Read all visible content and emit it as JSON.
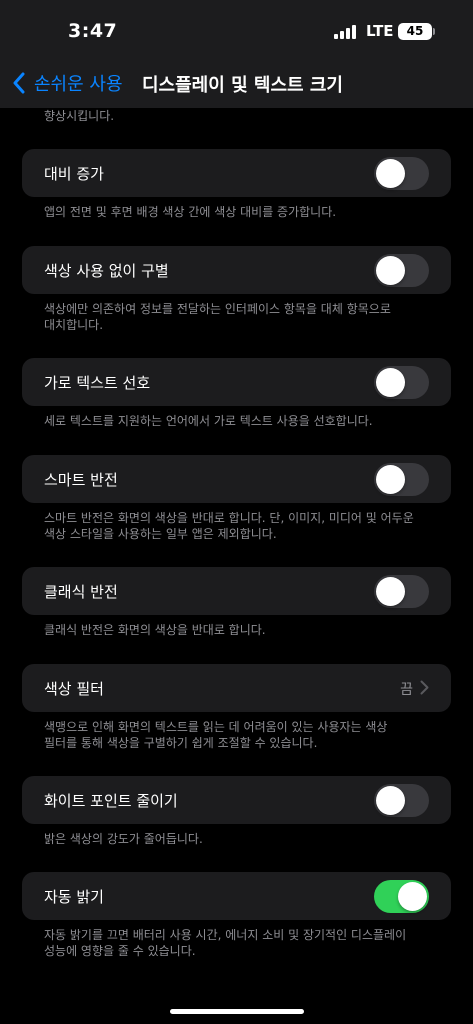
{
  "status_bar": {
    "time": "3:47",
    "network": "LTE",
    "battery": "45"
  },
  "nav": {
    "back_label": "손쉬운 사용",
    "title": "디스플레이 및 텍스트 크기"
  },
  "top_footer": "향상시킵니다.",
  "rows": [
    {
      "label": "대비 증가",
      "toggle": false,
      "footer": "앱의 전면 및 후면 배경 색상 간에 색상 대비를 증가합니다."
    },
    {
      "label": "색상 사용 없이 구별",
      "toggle": false,
      "footer_lines": [
        "색상에만 의존하여 정보를 전달하는 인터페이스 항목을 대체 항목으로",
        "대치합니다."
      ]
    },
    {
      "label": "가로 텍스트 선호",
      "toggle": false,
      "footer": "세로 텍스트를 지원하는 언어에서 가로 텍스트 사용을 선호합니다."
    },
    {
      "label": "스마트 반전",
      "toggle": false,
      "footer_lines": [
        "스마트 반전은 화면의 색상을 반대로 합니다. 단, 이미지, 미디어 및 어두운",
        "색상 스타일을 사용하는 일부 앱은 제외합니다."
      ]
    },
    {
      "label": "클래식 반전",
      "toggle": false,
      "footer": "클래식 반전은 화면의 색상을 반대로 합니다."
    },
    {
      "label": "색상 필터",
      "value": "끔",
      "footer_lines": [
        "색맹으로 인해 화면의 텍스트를 읽는 데 어려움이 있는 사용자는 색상",
        "필터를 통해 색상을 구별하기 쉽게 조절할 수 있습니다."
      ]
    },
    {
      "label": "화이트 포인트 줄이기",
      "toggle": false,
      "footer": "밝은 색상의 강도가 줄어듭니다."
    },
    {
      "label": "자동 밝기",
      "toggle": true,
      "footer_lines": [
        "자동 밝기를 끄면 배터리 사용 시간, 에너지 소비 및 장기적인 디스플레이",
        "성능에 영향을 줄 수 있습니다."
      ]
    }
  ],
  "colors": {
    "accent": "#0a84ff",
    "toggle_on": "#30d158",
    "toggle_off": "#39393d",
    "cell_bg": "#1c1c1e",
    "footer_text": "#8e8e93"
  }
}
